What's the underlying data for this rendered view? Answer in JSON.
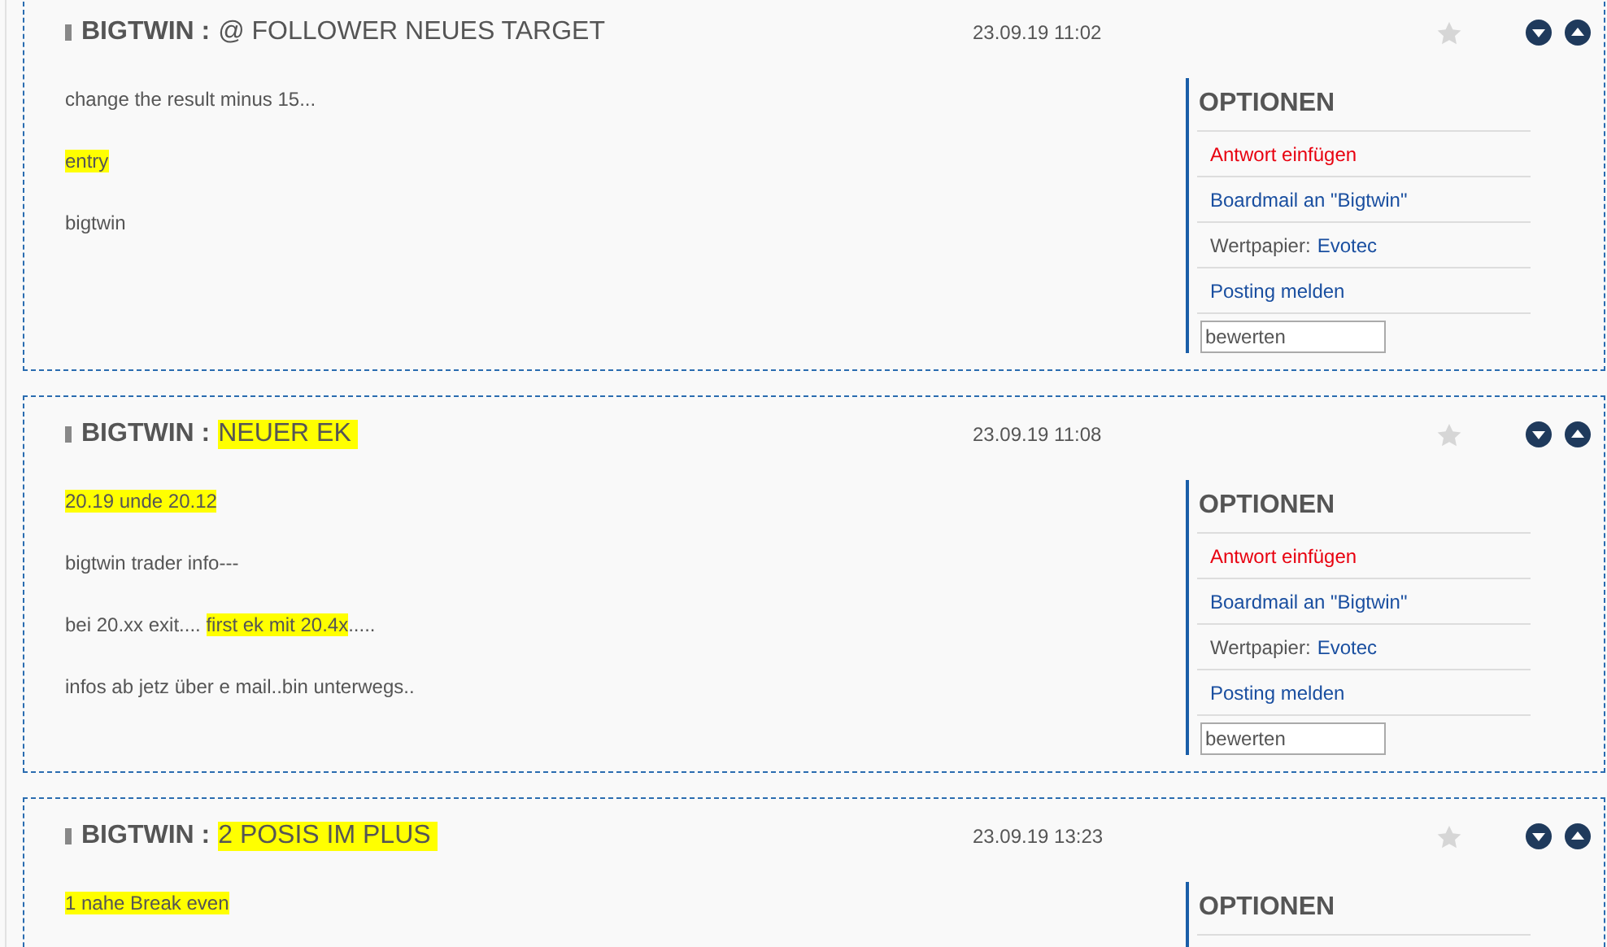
{
  "posts": [
    {
      "author": "BIGTWIN :",
      "title": {
        "text": "@ FOLLOWER NEUES TARGET",
        "highlighted": false
      },
      "date": "23.09.19 11:02",
      "body": [
        [
          {
            "text": "change the result minus 15...",
            "highlighted": false
          }
        ],
        [
          {
            "text": "entry",
            "highlighted": true
          }
        ],
        [
          {
            "text": "bigtwin",
            "highlighted": false
          }
        ]
      ],
      "options": {
        "heading": "OPTIONEN",
        "links": [
          {
            "kind": "reply",
            "text": "Antwort einfügen"
          },
          {
            "kind": "mail",
            "text": "Boardmail an \"Bigtwin\""
          },
          {
            "kind": "security",
            "label": "Wertpapier:",
            "text": "Evotec"
          },
          {
            "kind": "report",
            "text": "Posting melden"
          }
        ],
        "rating_field": {
          "value": "bewerten"
        }
      }
    },
    {
      "author": "BIGTWIN :",
      "title": {
        "text": "NEUER EK",
        "highlighted": true
      },
      "date": "23.09.19 11:08",
      "body": [
        [
          {
            "text": "20.19 unde 20.12",
            "highlighted": true
          }
        ],
        [
          {
            "text": "bigtwin trader info---",
            "highlighted": false
          }
        ],
        [
          {
            "text": "bei 20.xx exit.... ",
            "highlighted": false
          },
          {
            "text": "first ek mit 20.4x",
            "highlighted": true
          },
          {
            "text": ".....",
            "highlighted": false
          }
        ],
        [
          {
            "text": "infos ab jetz über e mail..bin unterwegs..",
            "highlighted": false
          }
        ]
      ],
      "options": {
        "heading": "OPTIONEN",
        "links": [
          {
            "kind": "reply",
            "text": "Antwort einfügen"
          },
          {
            "kind": "mail",
            "text": "Boardmail an \"Bigtwin\""
          },
          {
            "kind": "security",
            "label": "Wertpapier:",
            "text": "Evotec"
          },
          {
            "kind": "report",
            "text": "Posting melden"
          }
        ],
        "rating_field": {
          "value": "bewerten"
        }
      }
    },
    {
      "author": "BIGTWIN :",
      "title": {
        "text": "2 POSIS IM PLUS",
        "highlighted": true
      },
      "date": "23.09.19 13:23",
      "body": [
        [
          {
            "text": "1 nahe Break even",
            "highlighted": true
          }
        ]
      ],
      "options": {
        "heading": "OPTIONEN"
      }
    }
  ]
}
